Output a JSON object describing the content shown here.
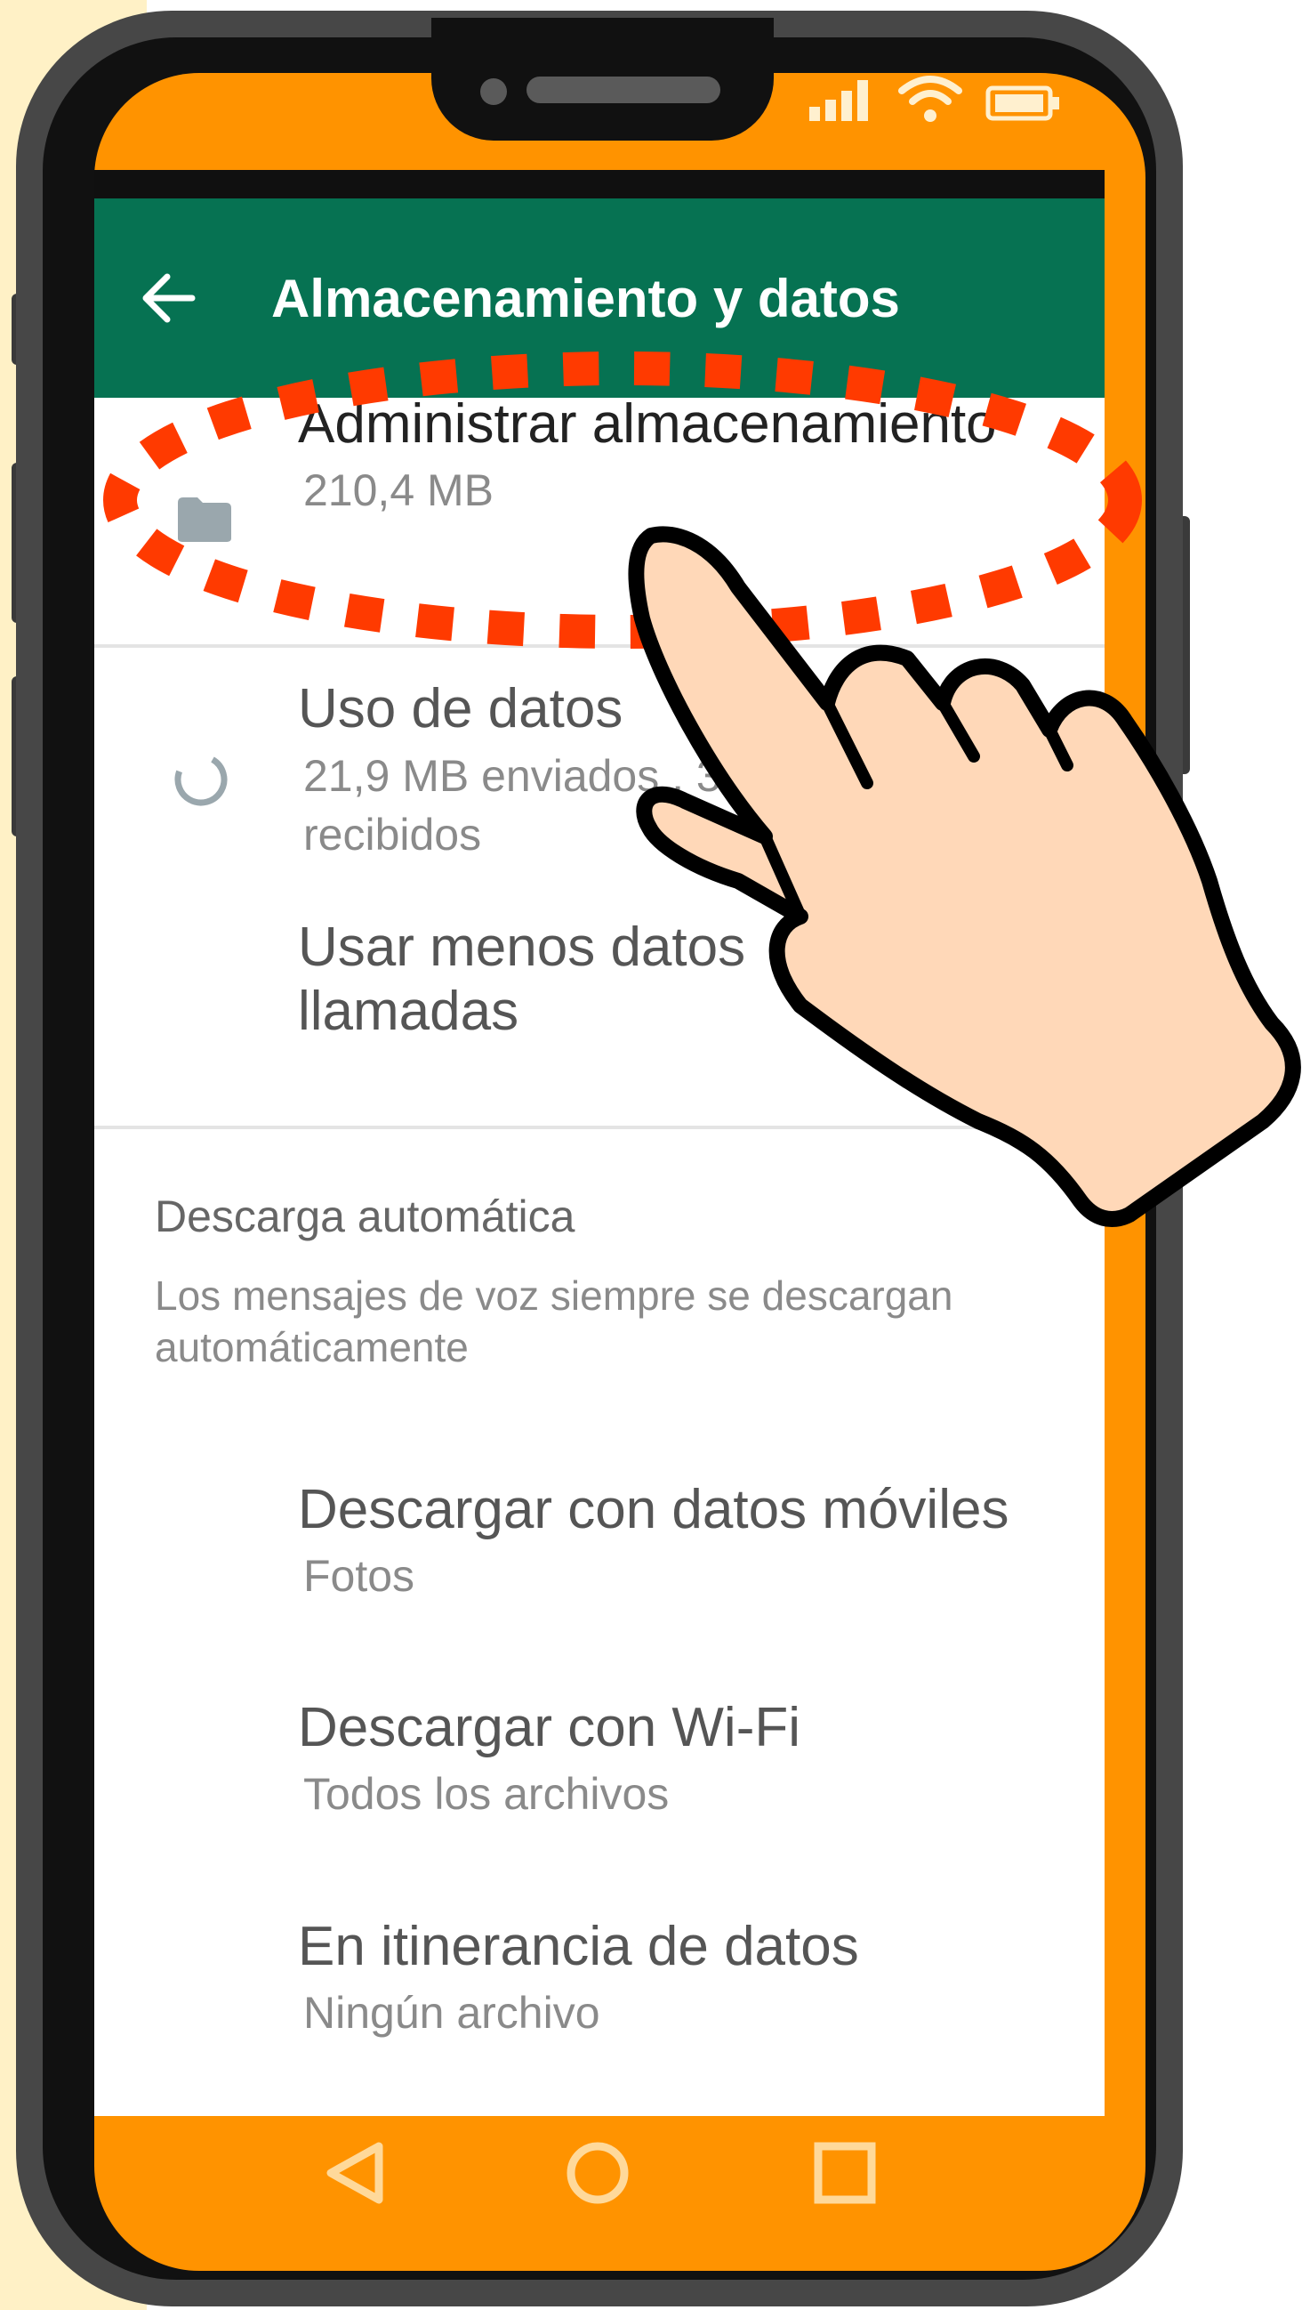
{
  "app_bar": {
    "title": "Almacenamiento y datos",
    "back_icon": "arrow-left-icon",
    "color": "#067252"
  },
  "settings": {
    "storage": {
      "title": "Administrar almacenamiento",
      "subtitle": "210,4 MB",
      "icon": "folder-icon"
    },
    "data_usage": {
      "title": "Uso de datos",
      "subtitle_line1": "21,9 MB enviados , 3",
      "subtitle_line2": "recibidos",
      "icon": "data-usage-icon"
    },
    "low_data_calls": {
      "title_line1": "Usar menos datos",
      "title_line2": "llamadas"
    }
  },
  "auto_download": {
    "header": "Descarga automática",
    "description": "Los mensajes de voz siempre se descargan automáticamente",
    "items": [
      {
        "title": "Descargar con datos móviles",
        "subtitle": "Fotos"
      },
      {
        "title": "Descargar con Wi-Fi",
        "subtitle": "Todos los archivos"
      },
      {
        "title": "En itinerancia de datos",
        "subtitle": "Ningún archivo"
      }
    ]
  },
  "nav_bar": {
    "icons": [
      "back-triangle-icon",
      "home-circle-icon",
      "recents-square-icon"
    ]
  },
  "status_bar": {
    "icons": [
      "signal-icon",
      "wifi-icon",
      "battery-icon"
    ]
  },
  "colors": {
    "frame_orange": "#ff9300",
    "highlight_red": "#ff3a00",
    "hand_skin": "#ffd8b8",
    "background": "#fff1c6"
  }
}
